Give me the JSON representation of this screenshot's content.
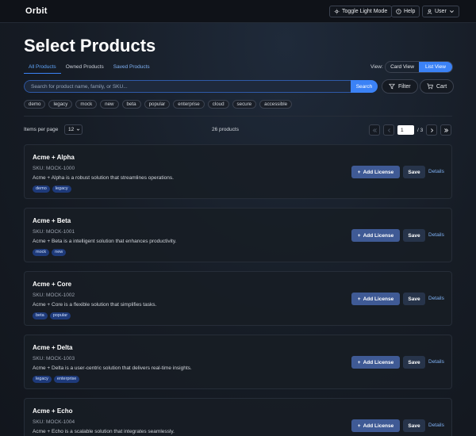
{
  "app": {
    "brand": "Orbit"
  },
  "topbar": {
    "toggle_theme": "Toggle Light Mode",
    "help": "Help",
    "user": "User"
  },
  "page": {
    "title": "Select Products"
  },
  "tabs": [
    {
      "label": "All Products",
      "active": true
    },
    {
      "label": "Owned Products",
      "active": false
    },
    {
      "label": "Saved Products",
      "active": false
    }
  ],
  "view": {
    "label": "View:",
    "options": [
      "Card View",
      "List View"
    ],
    "selected": "List View"
  },
  "search": {
    "placeholder": "Search for product name, family, or SKU...",
    "value": "",
    "button": "Search",
    "filter_button": "Filter",
    "cart_button": "Cart"
  },
  "chips": [
    "demo",
    "legacy",
    "mock",
    "new",
    "beta",
    "popular",
    "enterprise",
    "cloud",
    "secure",
    "accessible"
  ],
  "pagination": {
    "items_per_page_label": "Items per page",
    "items_per_page": "12",
    "count_text": "26 products",
    "current_page": "1",
    "total_pages": "/ 3"
  },
  "products": [
    {
      "name": "Acme + Alpha",
      "sku": "SKU: MOCK-1000",
      "description": "Acme + Alpha is a robust solution that streamlines operations.",
      "tags": [
        "demo",
        "legacy"
      ]
    },
    {
      "name": "Acme + Beta",
      "sku": "SKU: MOCK-1001",
      "description": "Acme + Beta is a intelligent solution that enhances productivity.",
      "tags": [
        "mock",
        "new"
      ]
    },
    {
      "name": "Acme + Core",
      "sku": "SKU: MOCK-1002",
      "description": "Acme + Core is a flexible solution that simplifies tasks.",
      "tags": [
        "beta",
        "popular"
      ]
    },
    {
      "name": "Acme + Delta",
      "sku": "SKU: MOCK-1003",
      "description": "Acme + Delta is a user-centric solution that delivers real-time insights.",
      "tags": [
        "legacy",
        "enterprise"
      ]
    },
    {
      "name": "Acme + Echo",
      "sku": "SKU: MOCK-1004",
      "description": "Acme + Echo is a scalable solution that integrates seamlessly.",
      "tags": []
    }
  ],
  "card_actions": {
    "add": "Add License",
    "save": "Save",
    "details": "Details"
  },
  "colors": {
    "accent": "#3b82f6",
    "tag_bg": "#1e3a7a",
    "link": "#7fb1f5"
  }
}
